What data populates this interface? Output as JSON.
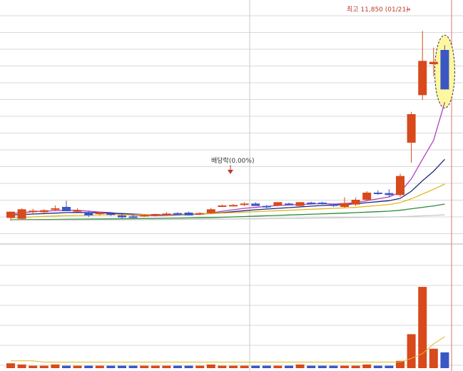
{
  "chart_data": {
    "type": "candlestick",
    "price_range": [
      7400,
      12500
    ],
    "volume_range": [
      0,
      100
    ],
    "annotations": {
      "high_label": "최고 11,850 (01/21)",
      "high_arrow": "→",
      "dividend_label": "배당락(0.00%)"
    },
    "candles": [
      {
        "o": 7920,
        "h": 8050,
        "l": 7860,
        "c": 8050
      },
      {
        "o": 7900,
        "h": 8120,
        "l": 7880,
        "c": 8100
      },
      {
        "o": 8050,
        "h": 8110,
        "l": 8000,
        "c": 8070
      },
      {
        "o": 8040,
        "h": 8100,
        "l": 7990,
        "c": 8080
      },
      {
        "o": 8100,
        "h": 8180,
        "l": 8060,
        "c": 8120
      },
      {
        "o": 8150,
        "h": 8280,
        "l": 8070,
        "c": 8060
      },
      {
        "o": 8070,
        "h": 8120,
        "l": 8040,
        "c": 8080
      },
      {
        "o": 8040,
        "h": 8070,
        "l": 7940,
        "c": 7970
      },
      {
        "o": 8000,
        "h": 8050,
        "l": 7970,
        "c": 8030
      },
      {
        "o": 8010,
        "h": 8040,
        "l": 7960,
        "c": 7980
      },
      {
        "o": 7970,
        "h": 8000,
        "l": 7910,
        "c": 7930
      },
      {
        "o": 7950,
        "h": 7990,
        "l": 7920,
        "c": 7940
      },
      {
        "o": 7960,
        "h": 8000,
        "l": 7940,
        "c": 7980
      },
      {
        "o": 7970,
        "h": 8010,
        "l": 7950,
        "c": 8000
      },
      {
        "o": 7980,
        "h": 8040,
        "l": 7960,
        "c": 8010
      },
      {
        "o": 8020,
        "h": 8040,
        "l": 7970,
        "c": 7990
      },
      {
        "o": 8030,
        "h": 8050,
        "l": 7970,
        "c": 7970
      },
      {
        "o": 8000,
        "h": 8040,
        "l": 7980,
        "c": 8020
      },
      {
        "o": 8020,
        "h": 8130,
        "l": 8000,
        "c": 8100
      },
      {
        "o": 8170,
        "h": 8200,
        "l": 8150,
        "c": 8180
      },
      {
        "o": 8190,
        "h": 8210,
        "l": 8160,
        "c": 8190
      },
      {
        "o": 8200,
        "h": 8250,
        "l": 8170,
        "c": 8220
      },
      {
        "o": 8220,
        "h": 8250,
        "l": 8180,
        "c": 8170
      },
      {
        "o": 8170,
        "h": 8190,
        "l": 8120,
        "c": 8150
      },
      {
        "o": 8180,
        "h": 8250,
        "l": 8160,
        "c": 8250
      },
      {
        "o": 8220,
        "h": 8240,
        "l": 8180,
        "c": 8200
      },
      {
        "o": 8170,
        "h": 8250,
        "l": 8150,
        "c": 8250
      },
      {
        "o": 8240,
        "h": 8260,
        "l": 8200,
        "c": 8230
      },
      {
        "o": 8240,
        "h": 8260,
        "l": 8200,
        "c": 8220
      },
      {
        "o": 8200,
        "h": 8220,
        "l": 8150,
        "c": 8180
      },
      {
        "o": 8150,
        "h": 8350,
        "l": 8130,
        "c": 8230
      },
      {
        "o": 8200,
        "h": 8350,
        "l": 8170,
        "c": 8300
      },
      {
        "o": 8300,
        "h": 8480,
        "l": 8280,
        "c": 8450
      },
      {
        "o": 8450,
        "h": 8500,
        "l": 8400,
        "c": 8420
      },
      {
        "o": 8440,
        "h": 8520,
        "l": 8360,
        "c": 8400
      },
      {
        "o": 8400,
        "h": 8850,
        "l": 8360,
        "c": 8800
      },
      {
        "o": 9500,
        "h": 10150,
        "l": 9080,
        "c": 10100
      },
      {
        "o": 10500,
        "h": 11850,
        "l": 10400,
        "c": 11220
      },
      {
        "o": 11150,
        "h": 11500,
        "l": 10900,
        "c": 11200
      },
      {
        "o": 11450,
        "h": 11550,
        "l": 10620,
        "c": 10620
      }
    ],
    "moving_averages": [
      {
        "name": "",
        "color": "#b23fbf",
        "values": [
          8010,
          8030,
          8050,
          8060,
          8070,
          8080,
          8080,
          8060,
          8040,
          8030,
          7995,
          7975,
          7970,
          7965,
          7975,
          7980,
          7990,
          7995,
          8020,
          8060,
          8090,
          8120,
          8140,
          8160,
          8180,
          8190,
          8200,
          8210,
          8220,
          8210,
          8220,
          8240,
          8280,
          8320,
          8360,
          8460,
          8740,
          9150,
          9550,
          10350
        ]
      },
      {
        "name": "",
        "color": "#1f2a80",
        "values": [
          7980,
          7990,
          8000,
          8010,
          8020,
          8030,
          8035,
          8030,
          8025,
          8020,
          8010,
          8000,
          7990,
          7985,
          7985,
          7990,
          7995,
          8000,
          8010,
          8030,
          8050,
          8070,
          8090,
          8105,
          8120,
          8135,
          8150,
          8165,
          8180,
          8190,
          8200,
          8215,
          8240,
          8260,
          8280,
          8330,
          8480,
          8700,
          8900,
          9150
        ]
      },
      {
        "name": "",
        "color": "#e0b820",
        "values": [
          7920,
          7930,
          7940,
          7950,
          7960,
          7965,
          7970,
          7975,
          7980,
          7985,
          7985,
          7985,
          7990,
          7990,
          7995,
          7995,
          8000,
          8005,
          8010,
          8020,
          8030,
          8040,
          8050,
          8060,
          8070,
          8080,
          8090,
          8100,
          8110,
          8120,
          8130,
          8140,
          8160,
          8180,
          8200,
          8240,
          8320,
          8420,
          8520,
          8630
        ]
      },
      {
        "name": "",
        "color": "#2e8b3a",
        "values": [
          7880,
          7882,
          7884,
          7886,
          7888,
          7890,
          7892,
          7894,
          7896,
          7898,
          7900,
          7902,
          7904,
          7906,
          7910,
          7914,
          7918,
          7922,
          7926,
          7932,
          7940,
          7948,
          7956,
          7964,
          7972,
          7980,
          7988,
          7996,
          8004,
          8012,
          8020,
          8030,
          8040,
          8050,
          8060,
          8080,
          8110,
          8140,
          8170,
          8210
        ]
      },
      {
        "name": "",
        "color": "#c8c8c8",
        "values": [
          7870,
          7871,
          7872,
          7873,
          7874,
          7875,
          7876,
          7877,
          7878,
          7879,
          7880,
          7881,
          7882,
          7883,
          7884,
          7886,
          7888,
          7890,
          7892,
          7894,
          7896,
          7898,
          7900,
          7902,
          7905,
          7908,
          7911,
          7914,
          7917,
          7920,
          7923,
          7926,
          7930,
          7934,
          7938,
          7944,
          7952,
          7962,
          7972,
          7984
        ]
      }
    ],
    "volume": [
      4,
      3,
      2,
      2,
      3,
      2,
      2,
      2,
      2,
      2,
      2,
      2,
      2,
      2,
      2,
      2,
      2,
      2,
      3,
      2,
      2,
      2,
      2,
      2,
      2,
      2,
      3,
      2,
      2,
      2,
      2,
      2,
      3,
      2,
      2,
      6,
      28,
      67,
      16,
      13
    ],
    "volume_ma": {
      "color": "#e0b820",
      "values": [
        6,
        6,
        6,
        5,
        5,
        5,
        5,
        5,
        5,
        5,
        5,
        5,
        5,
        5,
        5,
        5,
        5,
        5,
        5,
        5,
        5,
        5,
        5,
        5,
        5,
        5,
        5,
        5,
        5,
        5,
        5,
        5,
        5,
        5,
        5,
        5,
        8,
        12,
        20,
        26
      ]
    },
    "grid": true,
    "colors": {
      "up": "#d8491c",
      "down": "#3a57c4",
      "highlight": "#fff7a0",
      "grid": "#d9d9d9"
    }
  }
}
